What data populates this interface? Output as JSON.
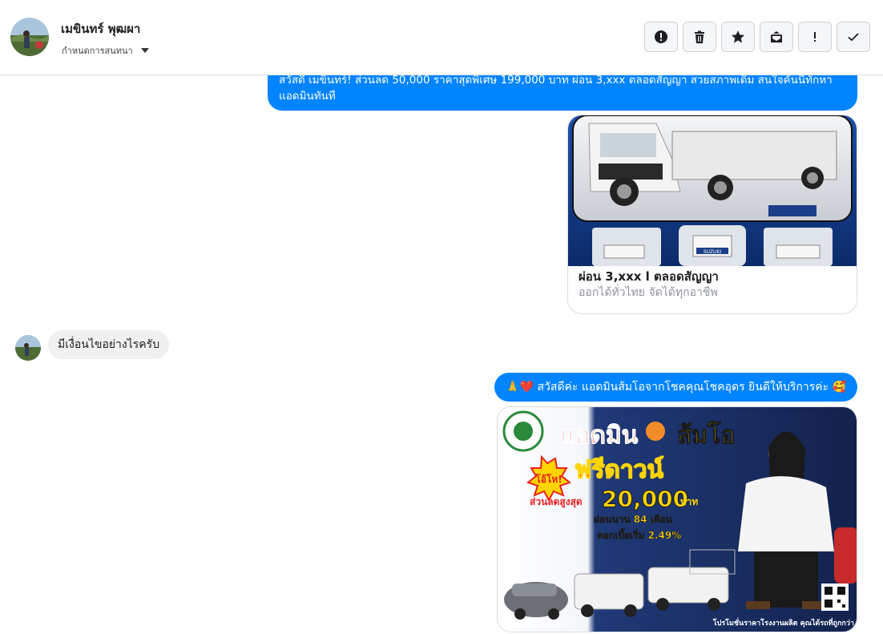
{
  "header": {
    "contact_name": "เมขินทร์ พุฒผา",
    "assign_label": "กำหนดการสนทนา",
    "actions": [
      {
        "icon": "alert-circle-icon",
        "label": "Mark as spam"
      },
      {
        "icon": "trash-icon",
        "label": "Delete"
      },
      {
        "icon": "star-icon",
        "label": "Star"
      },
      {
        "icon": "mail-unread-icon",
        "label": "Mark as unread"
      },
      {
        "icon": "exclamation-icon",
        "label": "Follow up"
      },
      {
        "icon": "check-icon",
        "label": "Done"
      }
    ]
  },
  "messages": {
    "msg1": "สวัสดี เมขินทร์! ส่วนลด 50,000 ราคาสุดพิเศษ 199,000 บาท ผ่อน 3,xxx ตลอดสัญญา สวยสภาพเดิม สนใจคันนี้ทักหาแอดมินทันที",
    "card": {
      "title": "ผ่อน 3,xxx l ตลอดสัญญา",
      "subtitle": "ออกได้ทั่วไทย จัดได้ทุกอาชีพ",
      "image_label": "SUZUKI"
    },
    "msg2": "มีเงื่อนไขอย่างไรครับ",
    "msg3": "🙏❤️ สวัสดีค่ะ แอดมินส้มโอจากโชคคุณโชคอุดร ยินดีให้บริการค่ะ 🥰",
    "promo": {
      "heading_1": "แอดมิน",
      "heading_2": "ส้มโอ",
      "burst": "โอ้โห!",
      "free_down": "ฟรีดาวน์",
      "discount_label": "ส่วนลดสูงสุด",
      "discount_value": "20,000",
      "discount_unit": "บาท",
      "installment": "ผ่อนนาน 84 เดือน",
      "interest": "ดอกเบี้ยเริ่ม 2.49%",
      "footer": "โปรโมชั่นราคาโรงงานผลิต คุณได้รถที่ถูกกว่า"
    }
  },
  "colors": {
    "outgoing_bubble": "#0084ff",
    "incoming_bubble": "#f0f0f0",
    "promo_bg": "#1d2c5e",
    "promo_red": "#e8201f",
    "promo_yellow": "#ffd400"
  }
}
